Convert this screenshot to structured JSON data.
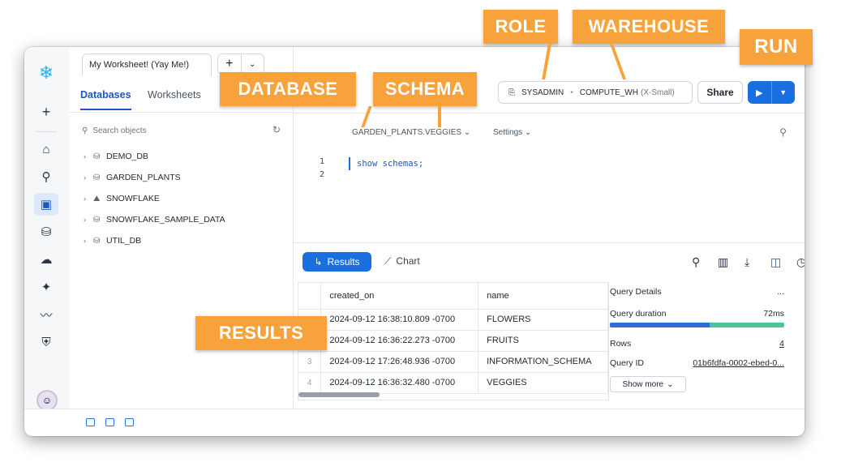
{
  "worksheet_tab": {
    "title": "My Worksheet! (Yay Me!)",
    "add": "+",
    "menu": "⌄"
  },
  "left_panel": {
    "tabs": [
      "Databases",
      "Worksheets"
    ],
    "search_placeholder": "Search objects",
    "databases": [
      "DEMO_DB",
      "GARDEN_PLANTS",
      "SNOWFLAKE",
      "SNOWFLAKE_SAMPLE_DATA",
      "UTIL_DB"
    ]
  },
  "topbar": {
    "role": "SYSADMIN",
    "warehouse": "COMPUTE_WH",
    "warehouse_size": "(X-Small)",
    "share_label": "Share"
  },
  "context": {
    "database_schema": "GARDEN_PLANTS.VEGGIES",
    "settings": "Settings"
  },
  "editor": {
    "line_numbers": [
      "1",
      "2"
    ],
    "code": "show schemas;"
  },
  "results_toolbar": {
    "results": "Results",
    "chart": "Chart"
  },
  "results": {
    "columns": [
      "created_on",
      "name"
    ],
    "rows": [
      {
        "n": "1",
        "created_on": "2024-09-12 16:38:10.809 -0700",
        "name": "FLOWERS"
      },
      {
        "n": "2",
        "created_on": "2024-09-12 16:36:22.273 -0700",
        "name": "FRUITS"
      },
      {
        "n": "3",
        "created_on": "2024-09-12 17:26:48.936 -0700",
        "name": "INFORMATION_SCHEMA"
      },
      {
        "n": "4",
        "created_on": "2024-09-12 16:36:32.480 -0700",
        "name": "VEGGIES"
      }
    ]
  },
  "query_details": {
    "title": "Query Details",
    "more": "...",
    "duration_label": "Query duration",
    "duration_value": "72ms",
    "duration_split": 0.57,
    "rows_label": "Rows",
    "rows_value": "4",
    "query_id_label": "Query ID",
    "query_id_value": "01b6fdfa-0002-ebed-0...",
    "show_more": "Show more"
  },
  "callouts": {
    "role": "ROLE",
    "warehouse": "WAREHOUSE",
    "run": "RUN",
    "database": "DATABASE",
    "schema": "SCHEMA",
    "results": "RESULTS"
  },
  "colors": {
    "accent": "#1a6fe0",
    "callout": "#f7a23b",
    "bar_blue": "#2f6ed8",
    "bar_green": "#4cc494"
  }
}
